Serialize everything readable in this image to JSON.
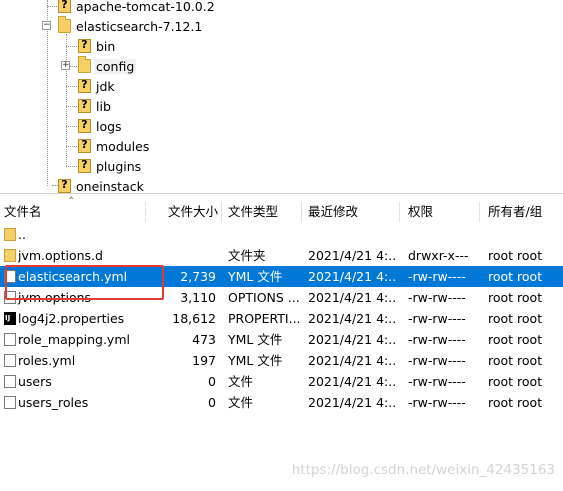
{
  "tree": {
    "items": [
      {
        "label": "apache-tomcat-10.0.2",
        "icon": "unknown-folder-icon"
      },
      {
        "label": "elasticsearch-7.12.1",
        "icon": "folder-icon"
      },
      {
        "label": "bin",
        "icon": "unknown-folder-icon"
      },
      {
        "label": "config",
        "icon": "folder-icon"
      },
      {
        "label": "jdk",
        "icon": "unknown-folder-icon"
      },
      {
        "label": "lib",
        "icon": "unknown-folder-icon"
      },
      {
        "label": "logs",
        "icon": "unknown-folder-icon"
      },
      {
        "label": "modules",
        "icon": "unknown-folder-icon"
      },
      {
        "label": "plugins",
        "icon": "unknown-folder-icon"
      },
      {
        "label": "oneinstack",
        "icon": "unknown-folder-icon"
      }
    ],
    "expanders": {
      "elasticsearch": "−",
      "config": "+"
    }
  },
  "table": {
    "columns": [
      "文件名",
      "文件大小",
      "文件类型",
      "最近修改",
      "权限",
      "所有者/组"
    ],
    "rows": [
      {
        "name": "..",
        "size": "",
        "type": "",
        "modified": "",
        "perms": "",
        "owner": "",
        "icon": "folder-icon"
      },
      {
        "name": "jvm.options.d",
        "size": "",
        "type": "文件夹",
        "modified": "2021/4/21 4:...",
        "perms": "drwxr-x---",
        "owner": "root root",
        "icon": "folder-icon"
      },
      {
        "name": "elasticsearch.yml",
        "size": "2,739",
        "type": "YML 文件",
        "modified": "2021/4/21 4:...",
        "perms": "-rw-rw----",
        "owner": "root root",
        "icon": "file-icon",
        "selected": true
      },
      {
        "name": "jvm.options",
        "size": "3,110",
        "type": "OPTIONS ...",
        "modified": "2021/4/21 4:...",
        "perms": "-rw-rw----",
        "owner": "root root",
        "icon": "file-icon"
      },
      {
        "name": "log4j2.properties",
        "size": "18,612",
        "type": "PROPERTI...",
        "modified": "2021/4/21 4:...",
        "perms": "-rw-rw----",
        "owner": "root root",
        "icon": "intellij-icon"
      },
      {
        "name": "role_mapping.yml",
        "size": "473",
        "type": "YML 文件",
        "modified": "2021/4/21 4:...",
        "perms": "-rw-rw----",
        "owner": "root root",
        "icon": "file-icon"
      },
      {
        "name": "roles.yml",
        "size": "197",
        "type": "YML 文件",
        "modified": "2021/4/21 4:...",
        "perms": "-rw-rw----",
        "owner": "root root",
        "icon": "file-icon"
      },
      {
        "name": "users",
        "size": "0",
        "type": "文件",
        "modified": "2021/4/21 4:...",
        "perms": "-rw-rw----",
        "owner": "root root",
        "icon": "file-icon"
      },
      {
        "name": "users_roles",
        "size": "0",
        "type": "文件",
        "modified": "2021/4/21 4:...",
        "perms": "-rw-rw----",
        "owner": "root root",
        "icon": "file-icon"
      }
    ]
  },
  "colors": {
    "selection": "#0078d7",
    "highlight_box": "#e53935",
    "folder": "#f6cf66"
  },
  "watermark": "https://blog.csdn.net/weixin_42435163"
}
